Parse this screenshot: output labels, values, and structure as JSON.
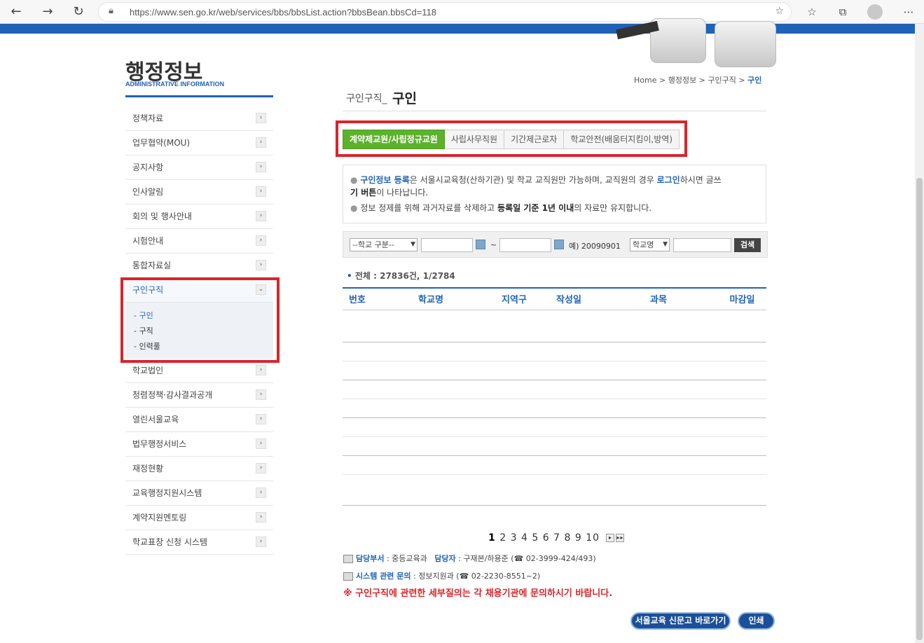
{
  "browser": {
    "url": "https://www.sen.go.kr/web/services/bbs/bbsList.action?bbsBean.bbsCd=118"
  },
  "sidebar": {
    "title": "행정정보",
    "subtitle": "ADMINISTRATIVE INFORMATION",
    "items": [
      {
        "label": "정책자료"
      },
      {
        "label": "업무협약(MOU)"
      },
      {
        "label": "공지사항"
      },
      {
        "label": "인사알림"
      },
      {
        "label": "회의 및 행사안내"
      },
      {
        "label": "시험안내"
      },
      {
        "label": "통합자료실"
      },
      {
        "label": "구인구직"
      },
      {
        "label": "학교법인"
      },
      {
        "label": "청렴정책·감사결과공개"
      },
      {
        "label": "열린서울교육"
      },
      {
        "label": "법무행정서비스"
      },
      {
        "label": "재정현황"
      },
      {
        "label": "교육행정지원시스템"
      },
      {
        "label": "계약지원멘토링"
      },
      {
        "label": "학교표창 신청 시스템"
      }
    ],
    "sub_items": [
      {
        "label": "- 구인"
      },
      {
        "label": "- 구직"
      },
      {
        "label": "- 인력풀"
      }
    ]
  },
  "breadcrumb": {
    "home": "Home",
    "b1": "행정정보",
    "b2": "구인구직",
    "current": "구인"
  },
  "page": {
    "title_prefix": "구인구직_",
    "title": "구인"
  },
  "tabs": [
    {
      "label": "계약제교원/사립정규교원"
    },
    {
      "label": "사립사무직원"
    },
    {
      "label": "기간제근로자"
    },
    {
      "label": "학교안전(배움터지킴이,방역)"
    }
  ],
  "notice": {
    "l1_a": "구인정보 등록",
    "l1_b": "은 서울시교육청(산하기관) 및 학교 교직원만 가능하며, 교직원의 경우 ",
    "l1_c": "로그인",
    "l1_d": "하시면 글쓰",
    "l2_a": "기 버튼",
    "l2_b": "이 나타납니다.",
    "l3_a": "정보 정제를 위해 과거자료를 삭제하고 ",
    "l3_b": "등록일 기준 1년 이내",
    "l3_c": "의 자료만 유지합니다."
  },
  "search": {
    "school_type": "--학교 구분--",
    "tilde": "~",
    "example": "예) 20090901",
    "field": "학교명",
    "button": "검색"
  },
  "total": "전체 : 27836건, 1/2784",
  "table": {
    "headers": [
      "번호",
      "학교명",
      "지역구",
      "작성일",
      "과목",
      "마감일"
    ]
  },
  "pagination": {
    "pages": [
      "1",
      "2",
      "3",
      "4",
      "5",
      "6",
      "7",
      "8",
      "9",
      "10"
    ],
    "next": "▸",
    "last": "▸▸"
  },
  "contact": {
    "dept_label": "담당부서",
    "dept": ": 중등교육과",
    "person_label": "담당자",
    "person": ": 구재본/하용준 (☎ 02-3999-424/493)",
    "sys_label": "시스템 관련 문의",
    "sys": ": 정보지원과 (☎ 02-2230-8551~2)"
  },
  "warning": "※ 구인구직에 관련한 세부질의는 각 채용기관에 문의하시기 바랍니다.",
  "buttons": {
    "newspaper": "서울교육 신문고 바로가기",
    "print": "인쇄"
  }
}
